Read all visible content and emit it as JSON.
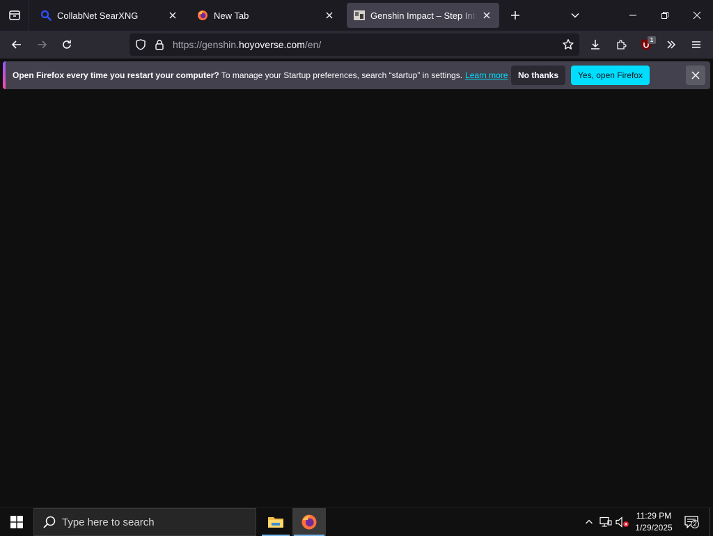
{
  "browser": {
    "tabs": [
      {
        "title": "CollabNet SearXNG",
        "icon": "search-icon",
        "active": false
      },
      {
        "title": "New Tab",
        "icon": "firefox-logo-icon",
        "active": false
      },
      {
        "title": "Genshin Impact – Step Into a Vast Magical World",
        "icon": "site-favicon-icon",
        "active": true
      }
    ],
    "url": {
      "prefix": "https://genshin.",
      "host": "hoyoverse.com",
      "suffix": "/en/"
    },
    "ublock_badge": "1",
    "notification": {
      "bold": "Open Firefox every time you restart your computer?",
      "text": " To manage your Startup preferences, search “startup” in settings.",
      "learn_more": "Learn more",
      "no_thanks": "No thanks",
      "yes": "Yes, open Firefox"
    },
    "colors": {
      "accent": "#00ddff",
      "chrome": "#2b2a33",
      "tabstrip": "#1c1b22"
    }
  },
  "taskbar": {
    "search_placeholder": "Type here to search",
    "time": "11:29 PM",
    "date": "1/29/2025",
    "notification_count": "2"
  }
}
